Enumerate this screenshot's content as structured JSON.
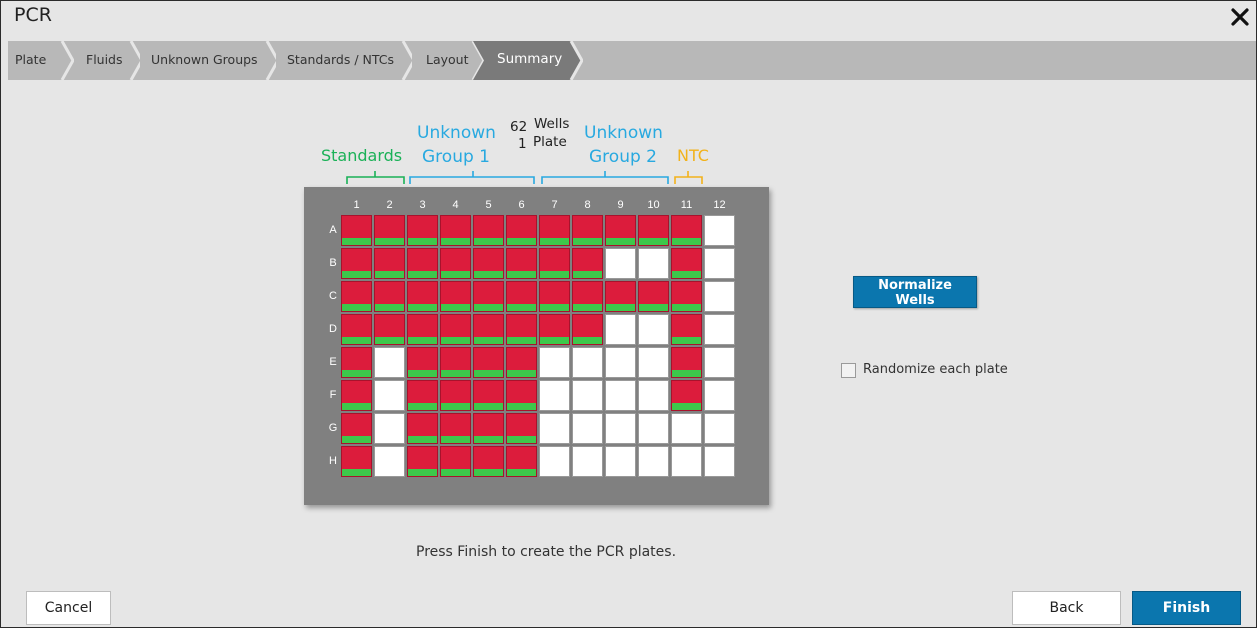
{
  "window": {
    "title": "PCR"
  },
  "breadcrumbs": [
    {
      "label": "Plate"
    },
    {
      "label": "Fluids"
    },
    {
      "label": "Unknown Groups"
    },
    {
      "label": "Standards / NTCs"
    },
    {
      "label": "Layout"
    },
    {
      "label": "Summary"
    }
  ],
  "annotations": {
    "standards": "Standards",
    "unknown1_line1": "Unknown",
    "unknown1_line2": "Group 1",
    "unknown2_line1": "Unknown",
    "unknown2_line2": "Group 2",
    "ntc": "NTC",
    "wells_count": "62",
    "wells_label": "Wells",
    "plate_count": "1",
    "plate_label": "Plate"
  },
  "plate": {
    "columns": [
      "1",
      "2",
      "3",
      "4",
      "5",
      "6",
      "7",
      "8",
      "9",
      "10",
      "11",
      "12"
    ],
    "rows": [
      "A",
      "B",
      "C",
      "D",
      "E",
      "F",
      "G",
      "H"
    ],
    "wells": [
      [
        1,
        1,
        1,
        1,
        1,
        1,
        1,
        1,
        1,
        1,
        1,
        0
      ],
      [
        1,
        1,
        1,
        1,
        1,
        1,
        1,
        1,
        0,
        0,
        1,
        0
      ],
      [
        1,
        1,
        1,
        1,
        1,
        1,
        1,
        1,
        1,
        1,
        1,
        0
      ],
      [
        1,
        1,
        1,
        1,
        1,
        1,
        1,
        1,
        0,
        0,
        1,
        0
      ],
      [
        1,
        0,
        1,
        1,
        1,
        1,
        0,
        0,
        0,
        0,
        1,
        0
      ],
      [
        1,
        0,
        1,
        1,
        1,
        1,
        0,
        0,
        0,
        0,
        1,
        0
      ],
      [
        1,
        0,
        1,
        1,
        1,
        1,
        0,
        0,
        0,
        0,
        0,
        0
      ],
      [
        1,
        0,
        1,
        1,
        1,
        1,
        0,
        0,
        0,
        0,
        0,
        0
      ]
    ]
  },
  "actions": {
    "normalize_label": "Normalize Wells",
    "randomize_label": "Randomize each plate",
    "randomize_checked": false
  },
  "instruction": "Press Finish to create the PCR plates.",
  "footer": {
    "cancel": "Cancel",
    "back": "Back",
    "finish": "Finish"
  },
  "colors": {
    "filled_well": "#dc1c3c",
    "bar": "#3dc84b",
    "primary": "#0b76ae",
    "standards": "#1ab157",
    "unknown": "#28a9e0",
    "ntc": "#f2b21b"
  }
}
